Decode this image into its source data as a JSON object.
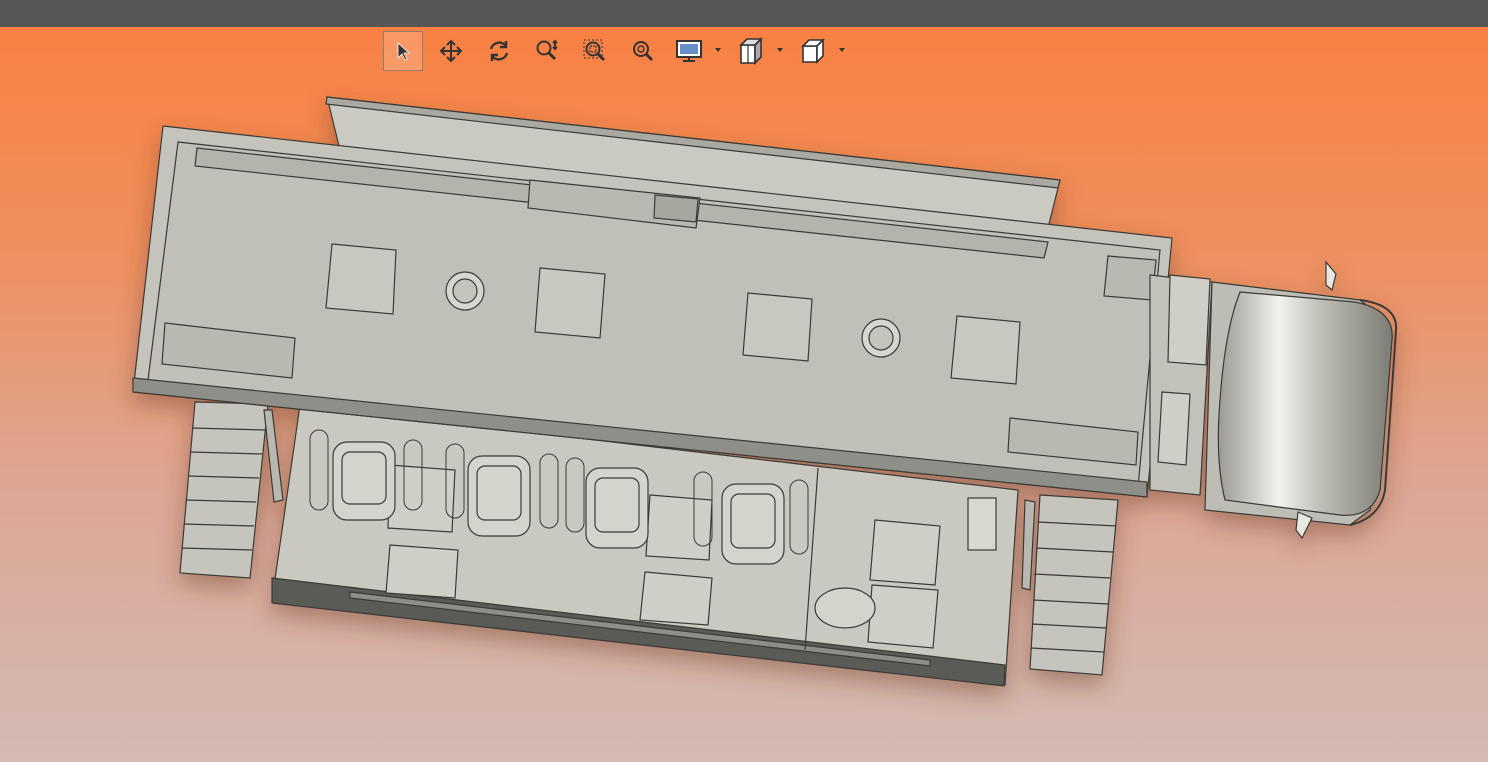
{
  "window": {
    "titlebar_color": "#575757"
  },
  "viewport": {
    "background_top": "#f98143",
    "background_bottom": "#d3bab3"
  },
  "toolbar": {
    "buttons": [
      {
        "name": "select-tool",
        "icon": "cursor-arrow-icon",
        "active": true
      },
      {
        "name": "pan-tool",
        "icon": "move-arrows-icon",
        "active": false
      },
      {
        "name": "rotate-tool",
        "icon": "rotate-icon",
        "active": false
      },
      {
        "name": "zoom-in-out-tool",
        "icon": "zoom-in-out-icon",
        "active": false
      },
      {
        "name": "zoom-window-tool",
        "icon": "zoom-window-icon",
        "active": false
      },
      {
        "name": "zoom-fit-tool",
        "icon": "zoom-fit-icon",
        "active": false
      },
      {
        "name": "display-mode-menu",
        "icon": "monitor-icon",
        "active": false,
        "dropdown": true
      },
      {
        "name": "section-view-menu",
        "icon": "section-box-icon",
        "active": false,
        "dropdown": true
      },
      {
        "name": "view-orientation-menu",
        "icon": "cube-icon",
        "active": false,
        "dropdown": true
      }
    ]
  },
  "model": {
    "description_color_body": "#c5c5bd",
    "stroke_color": "#3a3a36"
  }
}
